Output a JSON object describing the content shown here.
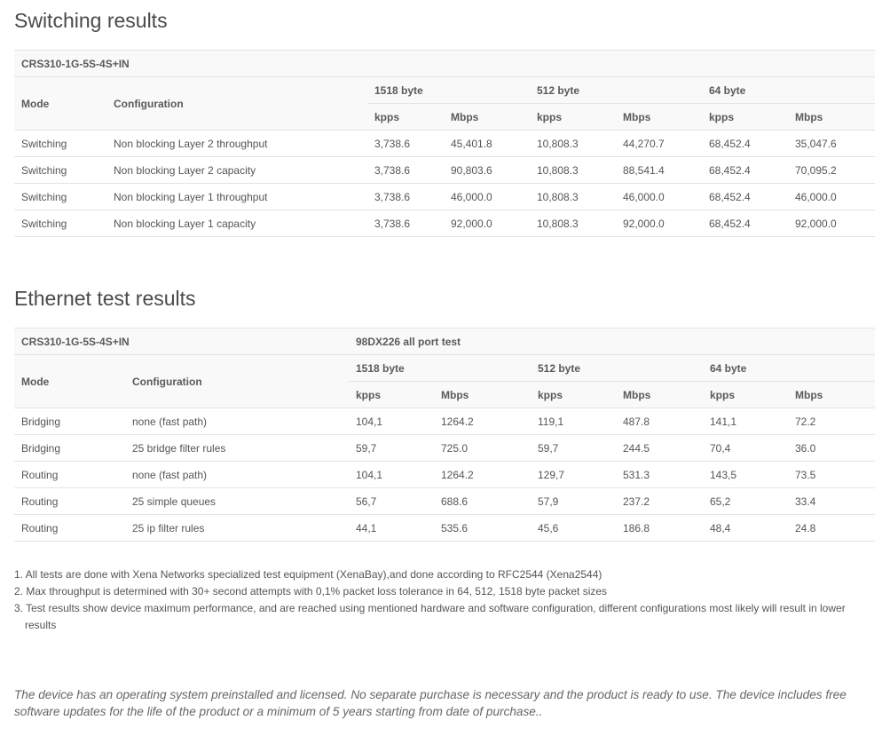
{
  "switching": {
    "title": "Switching results",
    "model": "CRS310-1G-5S-4S+IN",
    "headers": {
      "mode": "Mode",
      "configuration": "Configuration",
      "groups": [
        "1518 byte",
        "512 byte",
        "64 byte"
      ],
      "units": [
        "kpps",
        "Mbps",
        "kpps",
        "Mbps",
        "kpps",
        "Mbps"
      ]
    },
    "rows": [
      [
        "Switching",
        "Non blocking Layer 2 throughput",
        "3,738.6",
        "45,401.8",
        "10,808.3",
        "44,270.7",
        "68,452.4",
        "35,047.6"
      ],
      [
        "Switching",
        "Non blocking Layer 2 capacity",
        "3,738.6",
        "90,803.6",
        "10,808.3",
        "88,541.4",
        "68,452.4",
        "70,095.2"
      ],
      [
        "Switching",
        "Non blocking Layer 1 throughput",
        "3,738.6",
        "46,000.0",
        "10,808.3",
        "46,000.0",
        "68,452.4",
        "46,000.0"
      ],
      [
        "Switching",
        "Non blocking Layer 1 capacity",
        "3,738.6",
        "92,000.0",
        "10,808.3",
        "92,000.0",
        "68,452.4",
        "92,000.0"
      ]
    ]
  },
  "ethernet": {
    "title": "Ethernet test results",
    "model": "CRS310-1G-5S-4S+IN",
    "test": "98DX226 all port test",
    "headers": {
      "mode": "Mode",
      "configuration": "Configuration",
      "groups": [
        "1518 byte",
        "512 byte",
        "64 byte"
      ],
      "units": [
        "kpps",
        "Mbps",
        "kpps",
        "Mbps",
        "kpps",
        "Mbps"
      ]
    },
    "rows": [
      [
        "Bridging",
        "none (fast path)",
        "104,1",
        "1264.2",
        "119,1",
        "487.8",
        "141,1",
        "72.2"
      ],
      [
        "Bridging",
        "25 bridge filter rules",
        "59,7",
        "725.0",
        "59,7",
        "244.5",
        "70,4",
        "36.0"
      ],
      [
        "Routing",
        "none (fast path)",
        "104,1",
        "1264.2",
        "129,7",
        "531.3",
        "143,5",
        "73.5"
      ],
      [
        "Routing",
        "25 simple queues",
        "56,7",
        "688.6",
        "57,9",
        "237.2",
        "65,2",
        "33.4"
      ],
      [
        "Routing",
        "25 ip filter rules",
        "44,1",
        "535.6",
        "45,6",
        "186.8",
        "48,4",
        "24.8"
      ]
    ]
  },
  "notes": [
    "1. All tests are done with Xena Networks specialized test equipment (XenaBay),and done according to RFC2544 (Xena2544)",
    "2. Max throughput is determined with 30+ second attempts with 0,1% packet loss tolerance in 64, 512, 1518 byte packet sizes",
    "3. Test results show device maximum performance, and are reached using mentioned hardware and software configuration, different configurations most likely will result in lower results"
  ],
  "footer": "The device has an operating system preinstalled and licensed. No separate purchase is necessary and the product is ready to use. The device includes free software updates for the life of the product or a minimum of 5 years starting from date of purchase.."
}
